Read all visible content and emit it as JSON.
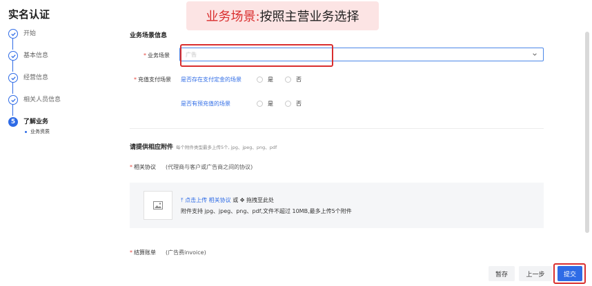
{
  "page_title": "实名认证",
  "steps": [
    {
      "label": "开始",
      "state": "done"
    },
    {
      "label": "基本信息",
      "state": "done"
    },
    {
      "label": "经营信息",
      "state": "done"
    },
    {
      "label": "相关人员信息",
      "state": "done"
    },
    {
      "label": "了解业务",
      "state": "active",
      "number": "5",
      "substep": "业务资质"
    }
  ],
  "callout": {
    "highlight": "业务场景:",
    "text": "按照主营业务选择"
  },
  "section1": {
    "title": "业务场景信息",
    "business_scene": {
      "required": "*",
      "label": "业务场景",
      "value": "广告"
    },
    "prepaid": {
      "required": "*",
      "label": "充值支付场景",
      "questions": [
        {
          "text": "是否存在支付定金的场景",
          "yes": "是",
          "no": "否"
        },
        {
          "text": "是否有预充值的场景",
          "yes": "是",
          "no": "否"
        }
      ]
    }
  },
  "section2": {
    "title": "请提供相应附件",
    "hint": "每个附件类型最多上传5个, jpg、jpeg、png、pdf",
    "agreement": {
      "required": "*",
      "label": "相关协议",
      "desc": "(代理商与客户或广告商之间的协议)"
    },
    "upload": {
      "click_upload": "点击上传",
      "doc_name": "相关协议",
      "or": "或",
      "drag": "拖拽至此处",
      "tip": "附件支持 jpg、jpeg、png、pdf,文件不超过 10MB,最多上传5个附件"
    },
    "invoice": {
      "required": "*",
      "label": "结算账单",
      "desc": "(广告费invoice)"
    }
  },
  "buttons": {
    "save": "暂存",
    "prev": "上一步",
    "submit": "提交"
  },
  "colors": {
    "primary": "#2e6be6",
    "annotation": "#d92d2d",
    "callout_bg": "#fce4e4"
  }
}
